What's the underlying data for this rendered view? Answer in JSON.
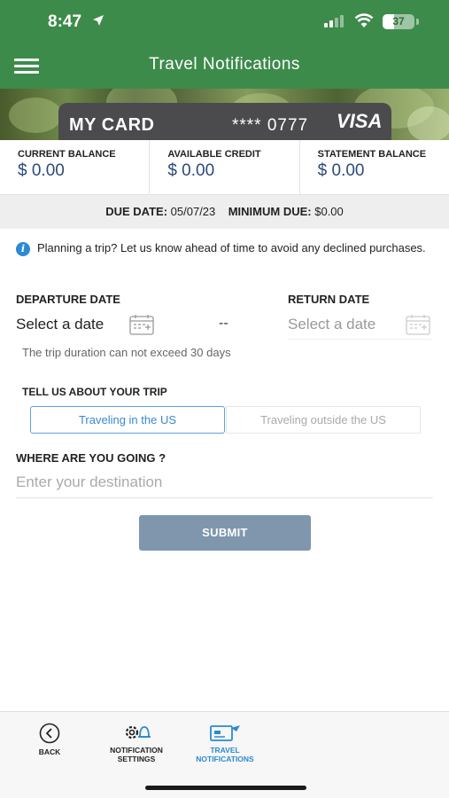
{
  "status_bar": {
    "time": "8:47",
    "battery": "37"
  },
  "header": {
    "title": "Travel Notifications"
  },
  "card": {
    "name": "MY CARD",
    "number": "**** 0777",
    "brand": "VISA"
  },
  "balances": [
    {
      "label": "CURRENT BALANCE",
      "value": "$ 0.00"
    },
    {
      "label": "AVAILABLE CREDIT",
      "value": "$ 0.00"
    },
    {
      "label": "STATEMENT BALANCE",
      "value": "$ 0.00"
    }
  ],
  "due": {
    "due_label": "DUE DATE:",
    "due_value": "05/07/23",
    "min_label": "MINIMUM DUE:",
    "min_value": "$0.00"
  },
  "info": {
    "text": "Planning a trip? Let us know ahead of time to avoid any declined purchases."
  },
  "dates": {
    "departure_label": "DEPARTURE DATE",
    "departure_placeholder": "Select a date",
    "separator": "--",
    "return_label": "RETURN DATE",
    "return_placeholder": "Select a date",
    "hint": "The trip duration can not exceed 30 days"
  },
  "trip": {
    "label": "TELL US ABOUT YOUR TRIP",
    "options": [
      "Traveling in the US",
      "Traveling outside the US"
    ],
    "selected": "Traveling in the US"
  },
  "destination": {
    "label": "WHERE ARE YOU GOING ?",
    "placeholder": "Enter your destination"
  },
  "submit": {
    "label": "SUBMIT"
  },
  "bottom_nav": {
    "back": "BACK",
    "notif_line1": "NOTIFICATION",
    "notif_line2": "SETTINGS",
    "travel_line1": "TRAVEL",
    "travel_line2": "NOTIFICATIONS"
  },
  "colors": {
    "header_bg": "#3d8b4a",
    "accent_blue": "#2a8bd0",
    "submit_bg": "#7f96ad",
    "balance_text": "#2d4a7a"
  }
}
